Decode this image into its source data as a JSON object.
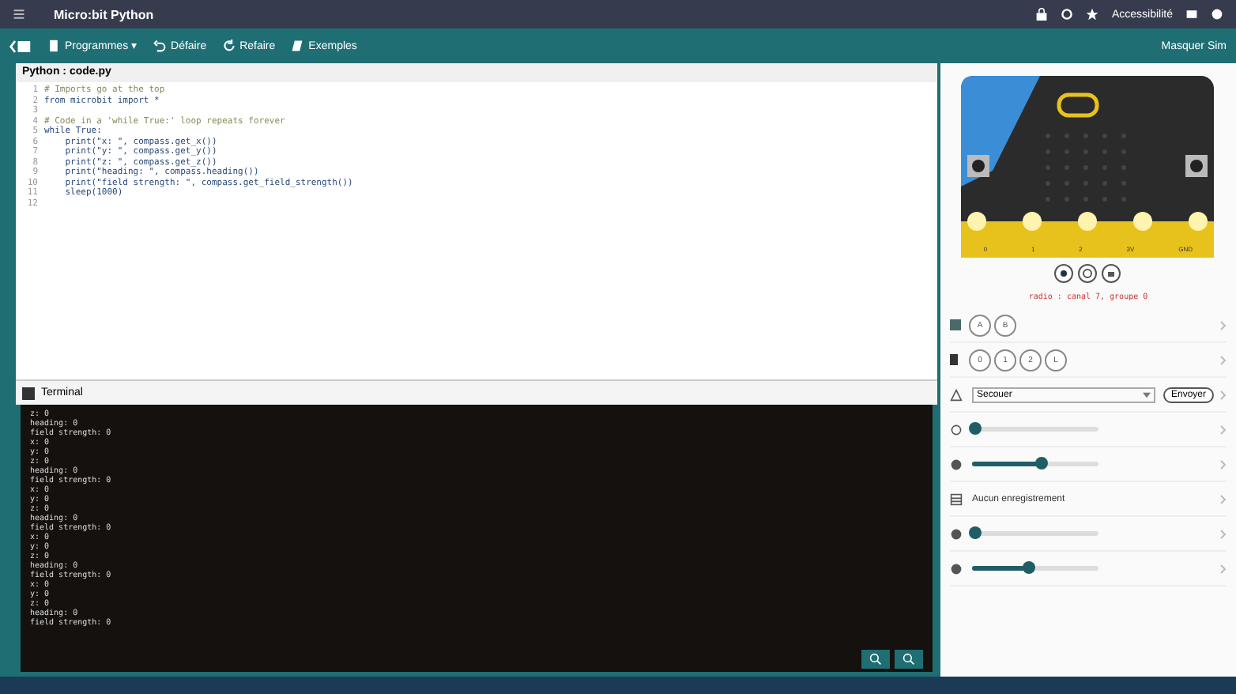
{
  "window": {
    "title": "Micro:bit Python"
  },
  "topbar": {
    "accessibility": "Accessibilité"
  },
  "toolbar": {
    "items": [
      {
        "label": "Programmes ▾",
        "kind": "file"
      },
      {
        "label": "Défaire",
        "kind": "undo"
      },
      {
        "label": "Refaire",
        "kind": "redo"
      },
      {
        "label": "Exemples",
        "kind": "book"
      }
    ],
    "hide_sim": "Masquer Sim"
  },
  "editor": {
    "title": "Python : code.py",
    "lines": [
      {
        "n": "1",
        "code": "# Imports go at the top"
      },
      {
        "n": "2",
        "code": "from microbit import *"
      },
      {
        "n": "3"
      },
      {
        "n": "4",
        "code": "# Code in a 'while True:' loop repeats forever"
      },
      {
        "n": "5",
        "code": "while True:"
      },
      {
        "n": "6",
        "code": "    print(\"x: \", compass.get_x())"
      },
      {
        "n": "7",
        "code": "    print(\"y: \", compass.get_y())"
      },
      {
        "n": "8",
        "code": "    print(\"z: \", compass.get_z())"
      },
      {
        "n": "9",
        "code": "    print(\"heading: \", compass.heading())"
      },
      {
        "n": "10",
        "code": "    print(\"field strength: \", compass.get_field_strength())"
      },
      {
        "n": "11",
        "code": "    sleep(1000)"
      },
      {
        "n": "12"
      }
    ]
  },
  "terminal": {
    "title": "Terminal",
    "lines": [
      "z: 0",
      "heading: 0",
      "field strength: 0",
      "x: 0",
      "y: 0",
      "z: 0",
      "heading: 0",
      "field strength: 0",
      "x: 0",
      "y: 0",
      "z: 0",
      "heading: 0",
      "field strength: 0",
      "x: 0",
      "y: 0",
      "z: 0",
      "heading: 0",
      "field strength: 0",
      "x: 0",
      "y: 0",
      "z: 0",
      "heading: 0",
      "field strength: 0"
    ]
  },
  "simulator": {
    "pins": [
      "0",
      "1",
      "2",
      "3V",
      "GND"
    ],
    "radio": "radio : canal 7, groupe 0",
    "sensors": [
      {
        "kind": "buttons",
        "labels": [
          "A",
          "B"
        ]
      },
      {
        "kind": "buttons",
        "labels": [
          "0",
          "1",
          "2",
          "L"
        ]
      },
      {
        "kind": "gesture",
        "value": "Secouer",
        "button": "Envoyer"
      },
      {
        "kind": "slider",
        "level": 0.02
      },
      {
        "kind": "slider",
        "level": 0.55
      },
      {
        "kind": "text",
        "text": "Aucun enregistrement"
      },
      {
        "kind": "slider",
        "level": 0.03
      },
      {
        "kind": "slider",
        "level": 0.45
      }
    ]
  }
}
